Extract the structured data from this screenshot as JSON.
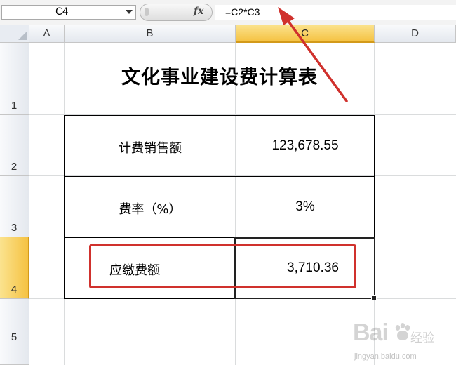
{
  "formula_bar": {
    "name_box": "C4",
    "fx_label": "fx",
    "formula": "=C2*C3"
  },
  "columns": [
    "A",
    "B",
    "C",
    "D"
  ],
  "rows": [
    "1",
    "2",
    "3",
    "4",
    "5"
  ],
  "selected_cell": "C4",
  "sheet": {
    "title": "文化事业建设费计算表",
    "table": [
      {
        "label": "计费销售额",
        "value": "123,678.55"
      },
      {
        "label": "费率（%）",
        "value": "3%"
      },
      {
        "label": "应缴费额",
        "value": "3,710.36"
      }
    ]
  },
  "colors": {
    "highlight_red": "#d0312d",
    "header_selected": "#f5c242"
  },
  "watermark": {
    "brand": "Bai",
    "brand_suffix": "经验",
    "url": "jingyan.baidu.com"
  }
}
